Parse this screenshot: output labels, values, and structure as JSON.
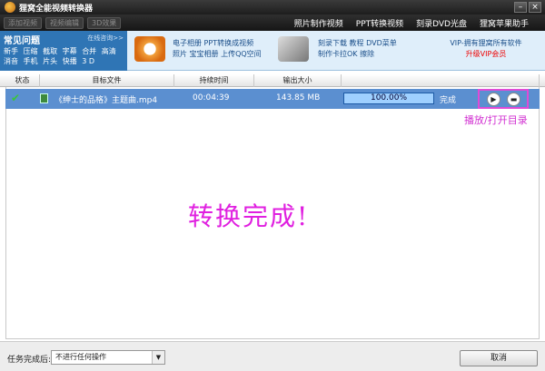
{
  "window": {
    "title": "狸窝全能视频转换器"
  },
  "toolbar": {
    "buttons": [
      "添加视频",
      "视频编辑",
      "3D效果"
    ],
    "links": [
      "照片制作视频",
      "PPT转换视频",
      "刻录DVD光盘",
      "狸窝苹果助手"
    ]
  },
  "banner": {
    "faq_title": "常见问题",
    "faq_online": "在线咨询>>",
    "faq_row1": [
      "新手",
      "压缩",
      "截取",
      "字幕",
      "合并",
      "高清"
    ],
    "faq_row2": [
      "消音",
      "手机",
      "片头",
      "快播",
      "3 D"
    ],
    "ad1_line1": "电子相册 PPT转换成视频",
    "ad1_line2": "照片 宝宝相册 上传QQ空间",
    "ad2_line1": "刻录下载 教程 DVD菜单",
    "ad2_line2": "制作卡拉OK 擦除",
    "vip_title": "VIP-拥有狸窝所有软件",
    "vip_link": "升级VIP会员"
  },
  "table": {
    "headers": [
      "状态",
      "目标文件",
      "持续时间",
      "输出大小",
      ""
    ],
    "row": {
      "file": "《绅士的品格》主题曲.mp4",
      "duration": "00:04:39",
      "size": "143.85 MB",
      "progress_text": "100.00%",
      "progress": 1.0,
      "status": "完成"
    }
  },
  "annotation": "播放/打开目录",
  "big_status": "转换完成!",
  "bottom": {
    "after_label": "任务完成后:",
    "after_value": "不进行任何操作",
    "cancel": "取消"
  },
  "colors": {
    "row_selected": "#5b8fd0",
    "annotation": "#e020e0",
    "banner_accent": "#2f75b5"
  }
}
